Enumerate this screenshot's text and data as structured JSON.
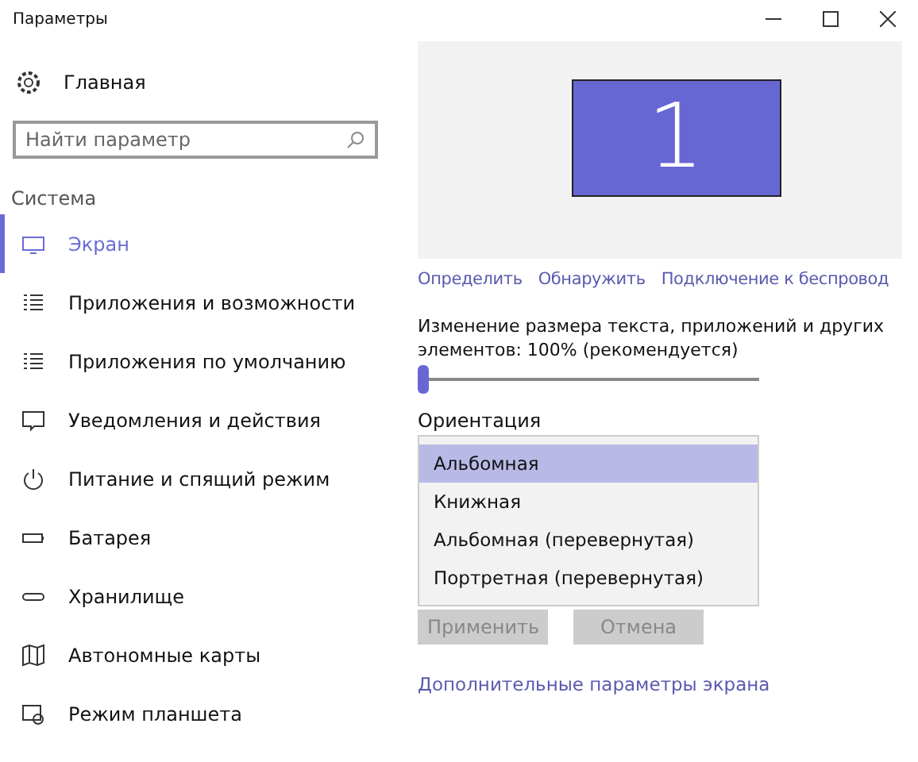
{
  "window": {
    "title": "Параметры"
  },
  "sidebar": {
    "home": "Главная",
    "search": {
      "placeholder": "Найти параметр"
    },
    "section": "Система",
    "items": [
      {
        "label": "Экран",
        "selected": true
      },
      {
        "label": "Приложения и возможности",
        "selected": false
      },
      {
        "label": "Приложения по умолчанию",
        "selected": false
      },
      {
        "label": "Уведомления и действия",
        "selected": false
      },
      {
        "label": "Питание и спящий режим",
        "selected": false
      },
      {
        "label": "Батарея",
        "selected": false
      },
      {
        "label": "Хранилище",
        "selected": false
      },
      {
        "label": "Автономные карты",
        "selected": false
      },
      {
        "label": "Режим планшета",
        "selected": false
      }
    ]
  },
  "display": {
    "monitor": "1",
    "links": [
      "Определить",
      "Обнаружить",
      "Подключение к беспровод"
    ],
    "scale": {
      "label": "Изменение размера текста, приложений и других элементов: 100% (рекомендуется)",
      "level": 0
    },
    "orientation": {
      "label": "Ориентация",
      "options": [
        {
          "label": "Альбомная",
          "selected": true
        },
        {
          "label": "Книжная",
          "selected": false
        },
        {
          "label": "Альбомная (перевернутая)",
          "selected": false
        },
        {
          "label": "Портретная (перевернутая)",
          "selected": false
        }
      ]
    },
    "buttons": [
      {
        "label": "Применить",
        "disabled": true
      },
      {
        "label": "Отмена",
        "disabled": true
      }
    ],
    "advanced_link": "Дополнительные параметры экрана"
  }
}
